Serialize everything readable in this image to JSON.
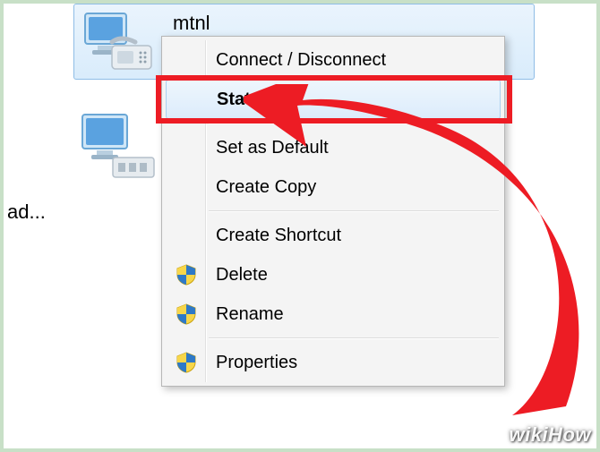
{
  "connection": {
    "name": "mtnl"
  },
  "truncated_label": "ad...",
  "context_menu": {
    "items": [
      {
        "label": "Connect / Disconnect",
        "icon": null,
        "hover": false,
        "bold": false
      },
      {
        "label": "Status",
        "icon": null,
        "hover": true,
        "bold": true
      },
      {
        "sep": true
      },
      {
        "label": "Set as Default",
        "icon": null,
        "hover": false,
        "bold": false
      },
      {
        "label": "Create Copy",
        "icon": null,
        "hover": false,
        "bold": false
      },
      {
        "sep": true
      },
      {
        "label": "Create Shortcut",
        "icon": null,
        "hover": false,
        "bold": false
      },
      {
        "label": "Delete",
        "icon": "shield",
        "hover": false,
        "bold": false
      },
      {
        "label": "Rename",
        "icon": "shield",
        "hover": false,
        "bold": false
      },
      {
        "sep": true
      },
      {
        "label": "Properties",
        "icon": "shield",
        "hover": false,
        "bold": false
      }
    ]
  },
  "watermark": "wikiHow"
}
